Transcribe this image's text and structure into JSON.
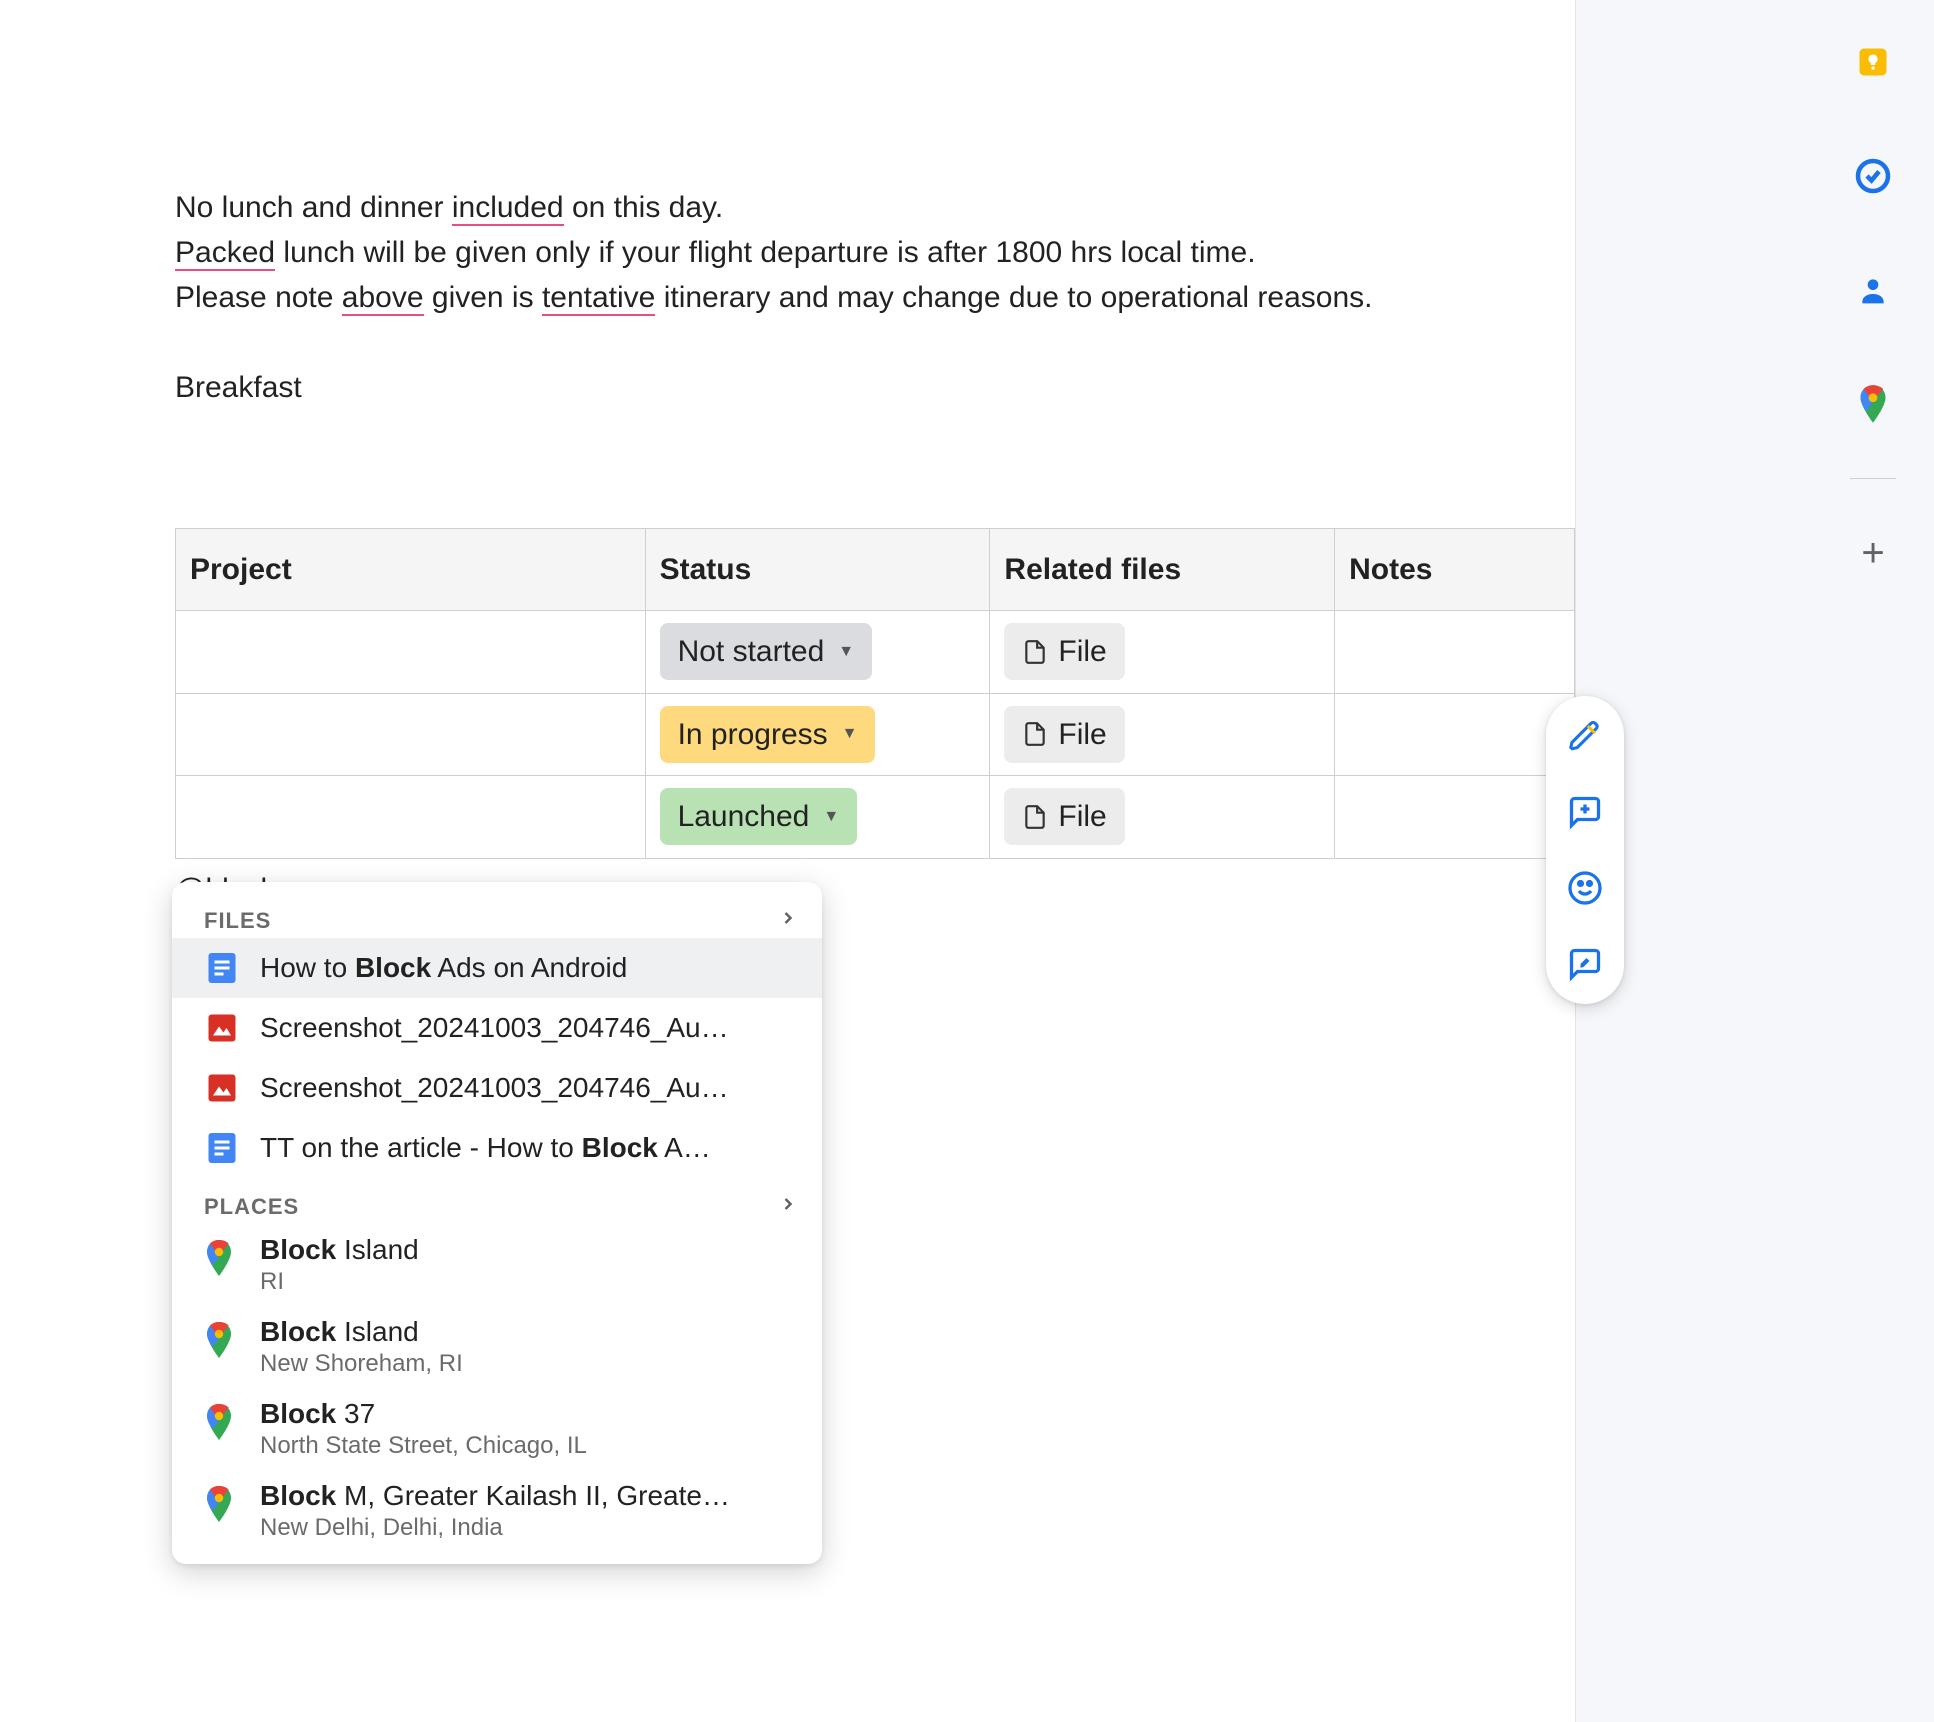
{
  "doc": {
    "para1_pre": "No lunch and dinner ",
    "para1_u1": "included",
    "para1_post": " on this day.",
    "para2_u1": "Packed",
    "para2_post": " lunch will be given only if your flight departure is after 1800 hrs local time.",
    "para3_pre": "Please note ",
    "para3_u1": "above",
    "para3_mid": " given is ",
    "para3_u2": "tentative",
    "para3_post": " itinerary and may change due to operational reasons.",
    "para4": "Breakfast"
  },
  "table": {
    "headers": {
      "project": "Project",
      "status": "Status",
      "related": "Related files",
      "notes": "Notes"
    },
    "rows": [
      {
        "status": "Not started",
        "file": "File"
      },
      {
        "status": "In progress",
        "file": "File"
      },
      {
        "status": "Launched",
        "file": "File"
      }
    ]
  },
  "mention_text": "@block",
  "popup": {
    "section_files": "FILES",
    "section_places": "PLACES",
    "files": [
      {
        "pre": "How to ",
        "bold": "Block",
        "post": " Ads on Android",
        "type": "doc"
      },
      {
        "pre": "Screenshot_20241003_204746_Au…",
        "bold": "",
        "post": "",
        "type": "img"
      },
      {
        "pre": "Screenshot_20241003_204746_Au…",
        "bold": "",
        "post": "",
        "type": "img"
      },
      {
        "pre": "TT on the article - How to ",
        "bold": "Block",
        "post": " A…",
        "type": "doc"
      }
    ],
    "places": [
      {
        "bold": "Block",
        "post": " Island",
        "sub": "RI"
      },
      {
        "bold": "Block",
        "post": " Island",
        "sub": "New Shoreham, RI"
      },
      {
        "bold": "Block",
        "post": " 37",
        "sub": "North State Street, Chicago, IL"
      },
      {
        "bold": "Block",
        "post": " M, Greater Kailash II, Greate…",
        "sub": "New Delhi, Delhi, India"
      }
    ]
  },
  "icons": {
    "keep": "keep-icon",
    "tasks": "tasks-icon",
    "contacts": "contacts-icon",
    "maps": "maps-icon",
    "add": "add-icon",
    "pencil": "pencil-icon",
    "add_comment": "add-comment-icon",
    "emoji": "emoji-icon",
    "suggest": "suggest-edits-icon"
  }
}
